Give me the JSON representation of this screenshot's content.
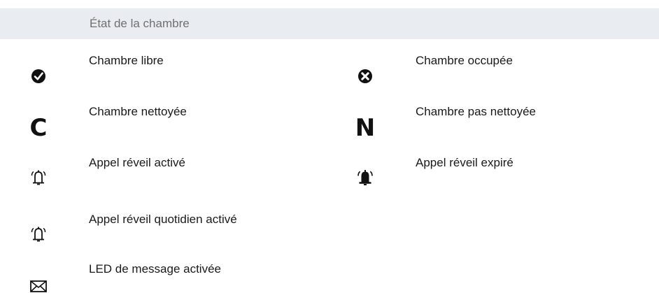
{
  "header": {
    "title": "État de la chambre"
  },
  "entries": [
    {
      "label": "Chambre libre",
      "icon": "check-circle-icon"
    },
    {
      "label": "Chambre occupée",
      "icon": "cross-circle-icon"
    },
    {
      "label": "Chambre nettoyée",
      "icon": "letter-c-icon",
      "glyph": "C"
    },
    {
      "label": "Chambre pas nettoyée",
      "icon": "letter-n-icon",
      "glyph": "N"
    },
    {
      "label": "Appel réveil activé",
      "icon": "bell-outline-icon"
    },
    {
      "label": "Appel réveil expiré",
      "icon": "bell-filled-icon"
    },
    {
      "label": "Appel réveil quotidien activé",
      "icon": "bell-outline-icon"
    },
    {
      "label": "LED de message activée",
      "icon": "envelope-icon"
    }
  ]
}
